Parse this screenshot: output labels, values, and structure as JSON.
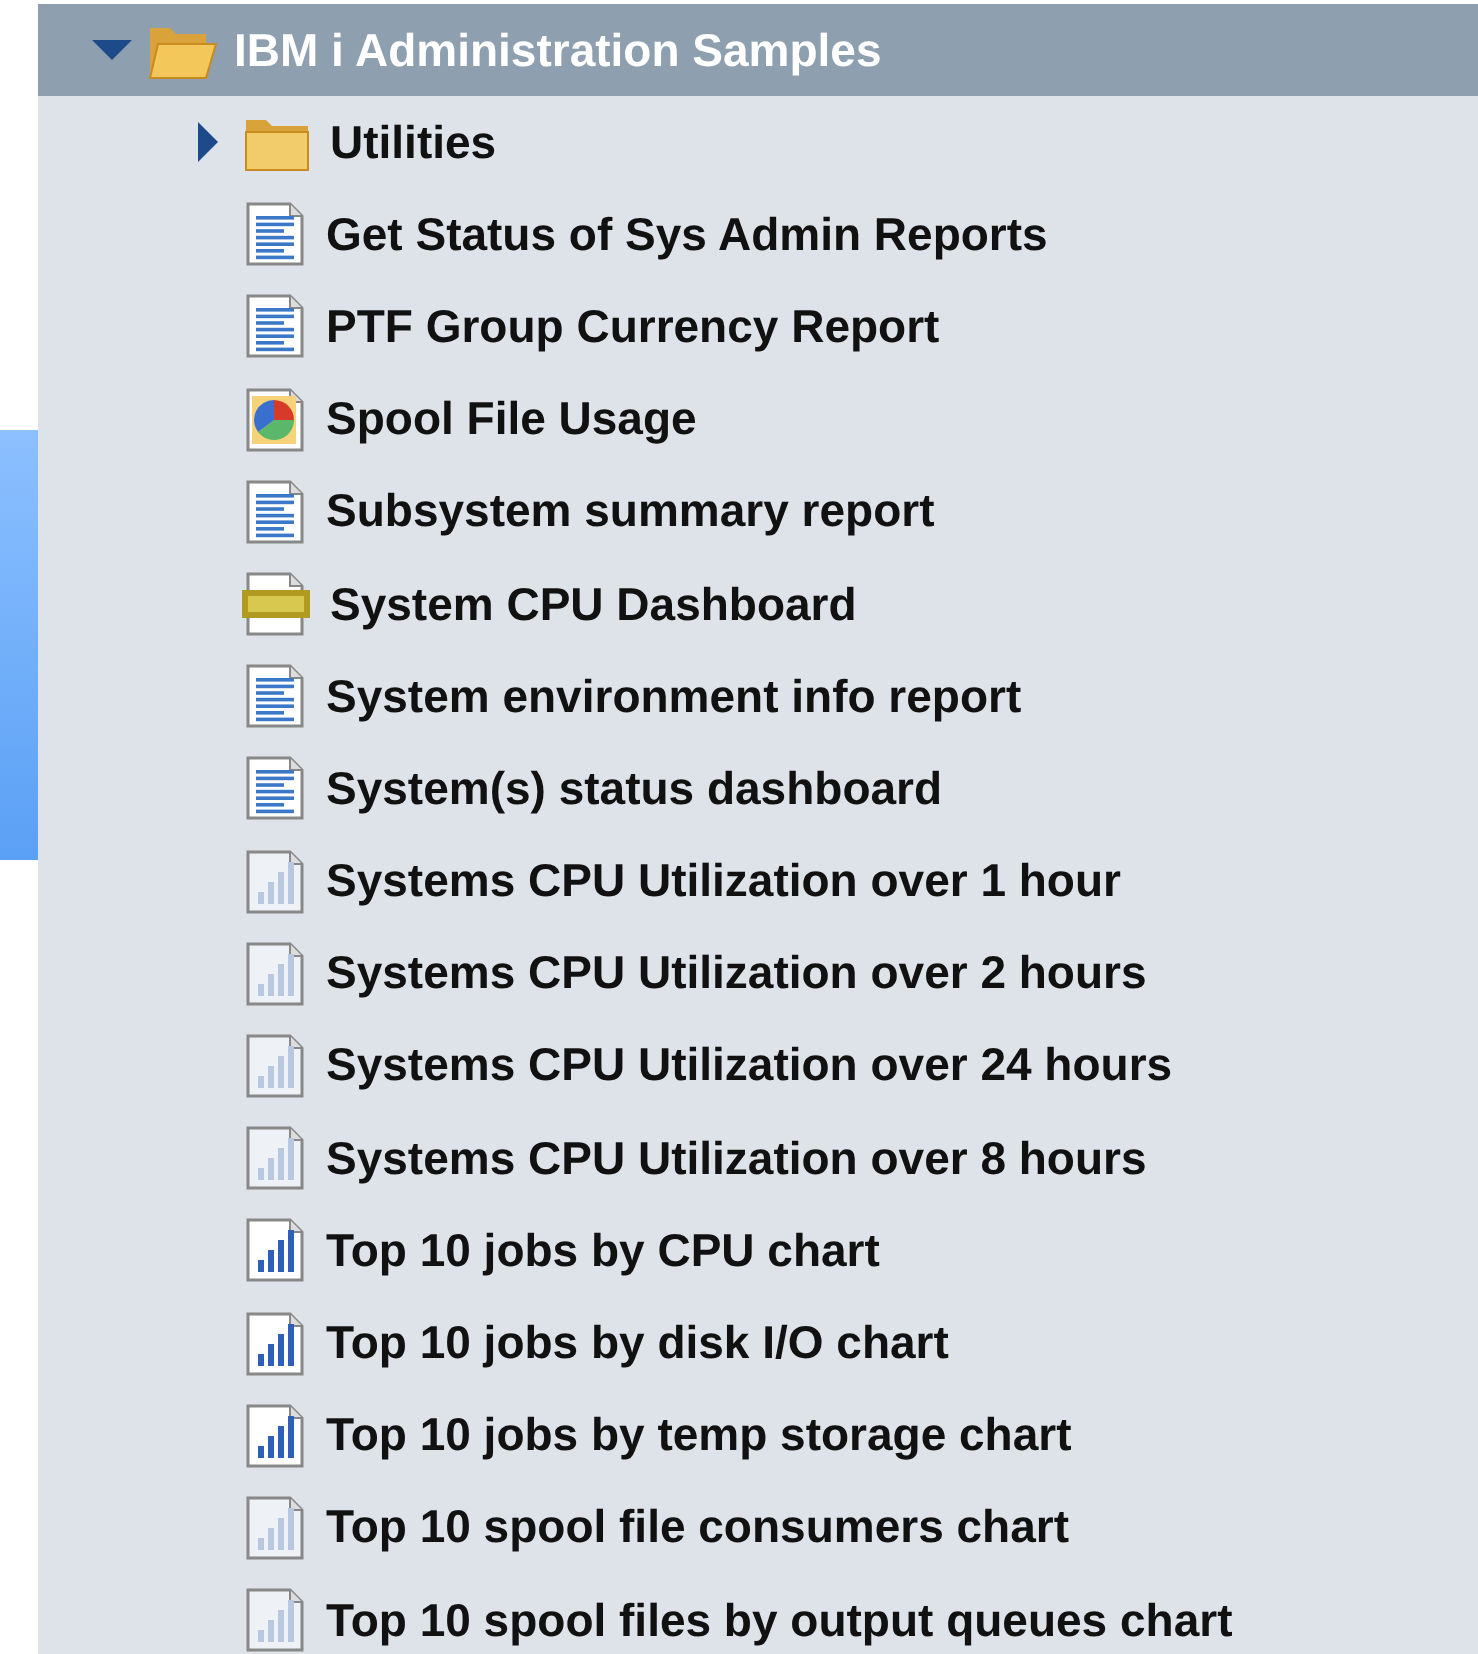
{
  "tree": {
    "label": "IBM i Administration Samples",
    "kind": "folder",
    "expanded": true,
    "selected": true,
    "children": [
      {
        "label": "Utilities",
        "kind": "folder",
        "expanded": false,
        "selected": false
      },
      {
        "label": "Get Status of Sys Admin Reports",
        "kind": "report",
        "selected": false
      },
      {
        "label": "PTF Group Currency Report",
        "kind": "report",
        "selected": false
      },
      {
        "label": "Spool File Usage",
        "kind": "pie",
        "selected": false
      },
      {
        "label": "Subsystem summary report",
        "kind": "report",
        "selected": false
      },
      {
        "label": "System CPU Dashboard",
        "kind": "html",
        "selected": false
      },
      {
        "label": "System environment info report",
        "kind": "report",
        "selected": false
      },
      {
        "label": "System(s) status dashboard",
        "kind": "report",
        "selected": false
      },
      {
        "label": "Systems CPU Utilization over 1 hour",
        "kind": "chart",
        "faded": true,
        "selected": false
      },
      {
        "label": "Systems CPU Utilization over 2 hours",
        "kind": "chart",
        "faded": true,
        "selected": false
      },
      {
        "label": "Systems CPU Utilization over 24 hours",
        "kind": "chart",
        "faded": true,
        "selected": false
      },
      {
        "label": "Systems CPU Utilization over 8 hours",
        "kind": "chart",
        "faded": true,
        "selected": false
      },
      {
        "label": "Top 10 jobs by CPU chart",
        "kind": "chart",
        "faded": false,
        "selected": false
      },
      {
        "label": "Top 10 jobs by disk I/O chart",
        "kind": "chart",
        "faded": false,
        "selected": false
      },
      {
        "label": "Top 10 jobs by temp storage chart",
        "kind": "chart",
        "faded": false,
        "selected": false
      },
      {
        "label": "Top 10 spool file consumers chart",
        "kind": "chart",
        "faded": true,
        "selected": false
      },
      {
        "label": "Top 10 spool files by output queues chart",
        "kind": "chart",
        "faded": true,
        "selected": false
      }
    ]
  }
}
